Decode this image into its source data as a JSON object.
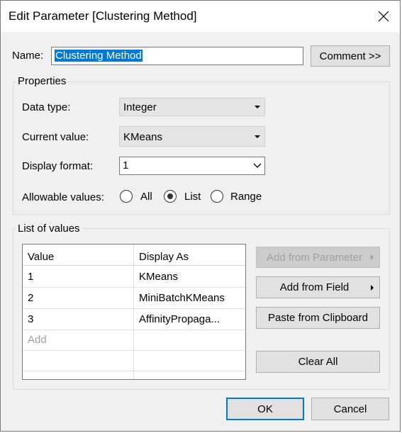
{
  "window": {
    "title": "Edit Parameter [Clustering Method]"
  },
  "name_field": {
    "label": "Name:",
    "value": "Clustering Method",
    "comment_button": "Comment >>"
  },
  "properties": {
    "title": "Properties",
    "data_type_label": "Data type:",
    "data_type_value": "Integer",
    "current_value_label": "Current value:",
    "current_value_value": "KMeans",
    "display_format_label": "Display format:",
    "display_format_value": "1",
    "allowable_label": "Allowable values:",
    "allowable_options": [
      "All",
      "List",
      "Range"
    ],
    "allowable_selected": "List"
  },
  "list_of_values": {
    "title": "List of values",
    "columns": [
      "Value",
      "Display As"
    ],
    "rows": [
      {
        "value": "1",
        "display": "KMeans"
      },
      {
        "value": "2",
        "display": "MiniBatchKMeans"
      },
      {
        "value": "3",
        "display": "AffinityPropaga..."
      }
    ],
    "add_placeholder": "Add",
    "buttons": {
      "add_from_parameter": "Add from Parameter",
      "add_from_field": "Add from Field",
      "paste_from_clipboard": "Paste from Clipboard",
      "clear_all": "Clear All"
    }
  },
  "footer": {
    "ok": "OK",
    "cancel": "Cancel"
  },
  "colors": {
    "selection": "#0078d7",
    "dialog_bg": "#f0f0f0",
    "button_bg": "#e1e1e1"
  }
}
